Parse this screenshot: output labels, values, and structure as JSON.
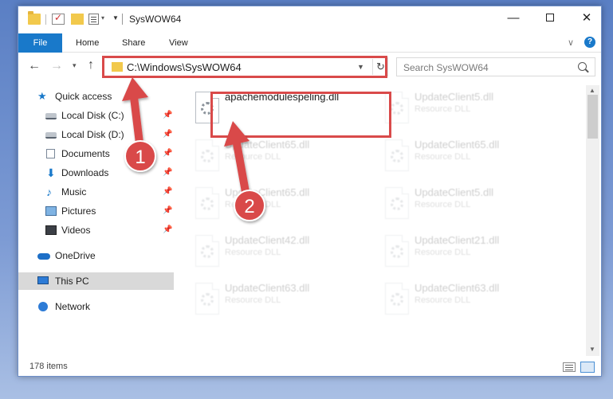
{
  "window": {
    "title": "SysWOW64",
    "controls": {
      "minimize": "—",
      "close": "✕"
    }
  },
  "ribbon": {
    "tabs": [
      "File",
      "Home",
      "Share",
      "View"
    ],
    "help": "?"
  },
  "navigation": {
    "address": "C:\\Windows\\SysWOW64",
    "search_placeholder": "Search SysWOW64"
  },
  "sidebar": {
    "items": [
      {
        "label": "Quick access",
        "icon": "star-icon"
      },
      {
        "label": "Local Disk (C:)",
        "icon": "drive-icon",
        "pinned": true
      },
      {
        "label": "Local Disk (D:)",
        "icon": "drive-icon",
        "pinned": true
      },
      {
        "label": "Documents",
        "icon": "documents-icon",
        "pinned": true
      },
      {
        "label": "Downloads",
        "icon": "downloads-icon",
        "pinned": true
      },
      {
        "label": "Music",
        "icon": "music-icon",
        "pinned": true
      },
      {
        "label": "Pictures",
        "icon": "pictures-icon",
        "pinned": true
      },
      {
        "label": "Videos",
        "icon": "videos-icon",
        "pinned": true
      },
      {
        "label": "OneDrive",
        "icon": "cloud-icon"
      },
      {
        "label": "This PC",
        "icon": "pc-icon",
        "selected": true
      },
      {
        "label": "Network",
        "icon": "network-icon"
      }
    ]
  },
  "files": [
    {
      "name": "apachemodulespeling.dll",
      "type": ""
    },
    {
      "name": "UpdateClient5.dll",
      "type": "Resource DLL"
    },
    {
      "name": "UpdateClient65.dll",
      "type": "Resource DLL"
    },
    {
      "name": "UpdateClient65.dll",
      "type": "Resource DLL"
    },
    {
      "name": "UpdateClient65.dll",
      "type": "Resource DLL"
    },
    {
      "name": "UpdateClient5.dll",
      "type": "Resource DLL"
    },
    {
      "name": "UpdateClient42.dll",
      "type": "Resource DLL"
    },
    {
      "name": "UpdateClient21.dll",
      "type": "Resource DLL"
    },
    {
      "name": "UpdateClient63.dll",
      "type": "Resource DLL"
    },
    {
      "name": "UpdateClient63.dll",
      "type": "Resource DLL"
    }
  ],
  "status": {
    "item_count": "178 items"
  },
  "annotations": [
    {
      "label": "1",
      "color": "#d94a4a"
    },
    {
      "label": "2",
      "color": "#d94a4a"
    }
  ]
}
